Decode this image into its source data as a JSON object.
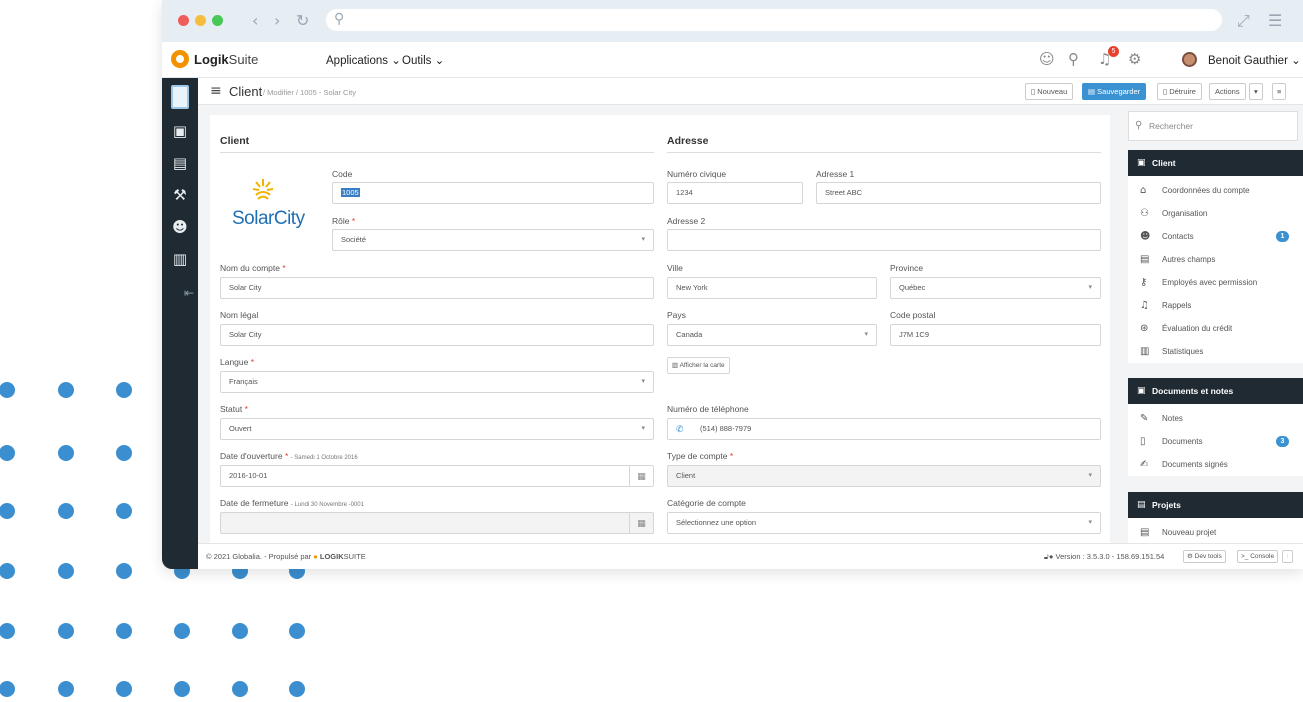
{
  "topbar": {
    "brand_bold": "Logik",
    "brand_light": "Suite",
    "menu_applications": "Applications",
    "menu_outils": "Outils",
    "notif_count": "5",
    "user_name": "Benoit Gauthier"
  },
  "breadcrumb": {
    "title": "Client",
    "path": "/  Modifier  /  1005 - Solar City"
  },
  "toolbar": {
    "new_label": "Nouveau",
    "save_label": "Sauvegarder",
    "delete_label": "Détruire",
    "actions_label": "Actions"
  },
  "form": {
    "client_heading": "Client",
    "address_heading": "Adresse",
    "logo_text": "SolarCity",
    "code_label": "Code",
    "code_value": "1005",
    "role_label": "Rôle",
    "role_value": "Société",
    "account_name_label": "Nom du compte",
    "account_name_value": "Solar City",
    "legal_name_label": "Nom légal",
    "legal_name_value": "Solar City",
    "language_label": "Langue",
    "language_value": "Français",
    "status_label": "Statut",
    "status_value": "Ouvert",
    "open_date_label": "Date d'ouverture",
    "open_date_sub": "- Samedi 1 Octobre 2016",
    "open_date_value": "2016-10-01",
    "close_date_label": "Date de fermeture",
    "close_date_sub": "- Lundi 30 Novembre -0001",
    "close_date_value": "",
    "street_no_label": "Numéro civique",
    "street_no_value": "1234",
    "address1_label": "Adresse 1",
    "address1_value": "Street ABC",
    "address2_label": "Adresse 2",
    "address2_value": "",
    "city_label": "Ville",
    "city_value": "New York",
    "province_label": "Province",
    "province_value": "Québec",
    "country_label": "Pays",
    "country_value": "Canada",
    "postal_label": "Code postal",
    "postal_value": "J7M 1C9",
    "map_button": "Afficher la carte",
    "phone_label": "Numéro de téléphone",
    "phone_value": "(514) 888-7979",
    "account_type_label": "Type de compte",
    "account_type_value": "Client",
    "category_label": "Catégorie de compte",
    "category_value": "Sélectionnez une option"
  },
  "right_panel": {
    "search_placeholder": "Rechercher",
    "client_header": "Client",
    "client_items": [
      {
        "label": "Coordonnées du compte",
        "icon": "home-icon"
      },
      {
        "label": "Organisation",
        "icon": "org-chart-icon"
      },
      {
        "label": "Contacts",
        "icon": "people-icon",
        "badge": "1"
      },
      {
        "label": "Autres champs",
        "icon": "list-icon"
      },
      {
        "label": "Employés avec permission",
        "icon": "user-key-icon"
      },
      {
        "label": "Rappels",
        "icon": "bell-icon"
      },
      {
        "label": "Évaluation du crédit",
        "icon": "credit-icon"
      },
      {
        "label": "Statistiques",
        "icon": "bar-chart-icon"
      }
    ],
    "docs_header": "Documents et notes",
    "docs_items": [
      {
        "label": "Notes",
        "icon": "edit-icon"
      },
      {
        "label": "Documents",
        "icon": "file-icon",
        "badge": "3"
      },
      {
        "label": "Documents signés",
        "icon": "signed-file-icon"
      }
    ],
    "projects_header": "Projets",
    "projects_items": [
      {
        "label": "Nouveau projet",
        "icon": "briefcase-icon"
      }
    ]
  },
  "footer": {
    "copyright": "© 2021 Globalia. - Propulsé par",
    "brand_bold": "LOGIK",
    "brand_light": "SUITE",
    "version": "Version : 3.5.3.0 - 158.69.151.54",
    "dev_tools": "Dev tools",
    "console": ">_ Console"
  },
  "colors": {
    "accent": "#3b92d2",
    "sidebar": "#1f2a33",
    "brand_orange": "#f39200",
    "dots": "#3b8fd0"
  }
}
